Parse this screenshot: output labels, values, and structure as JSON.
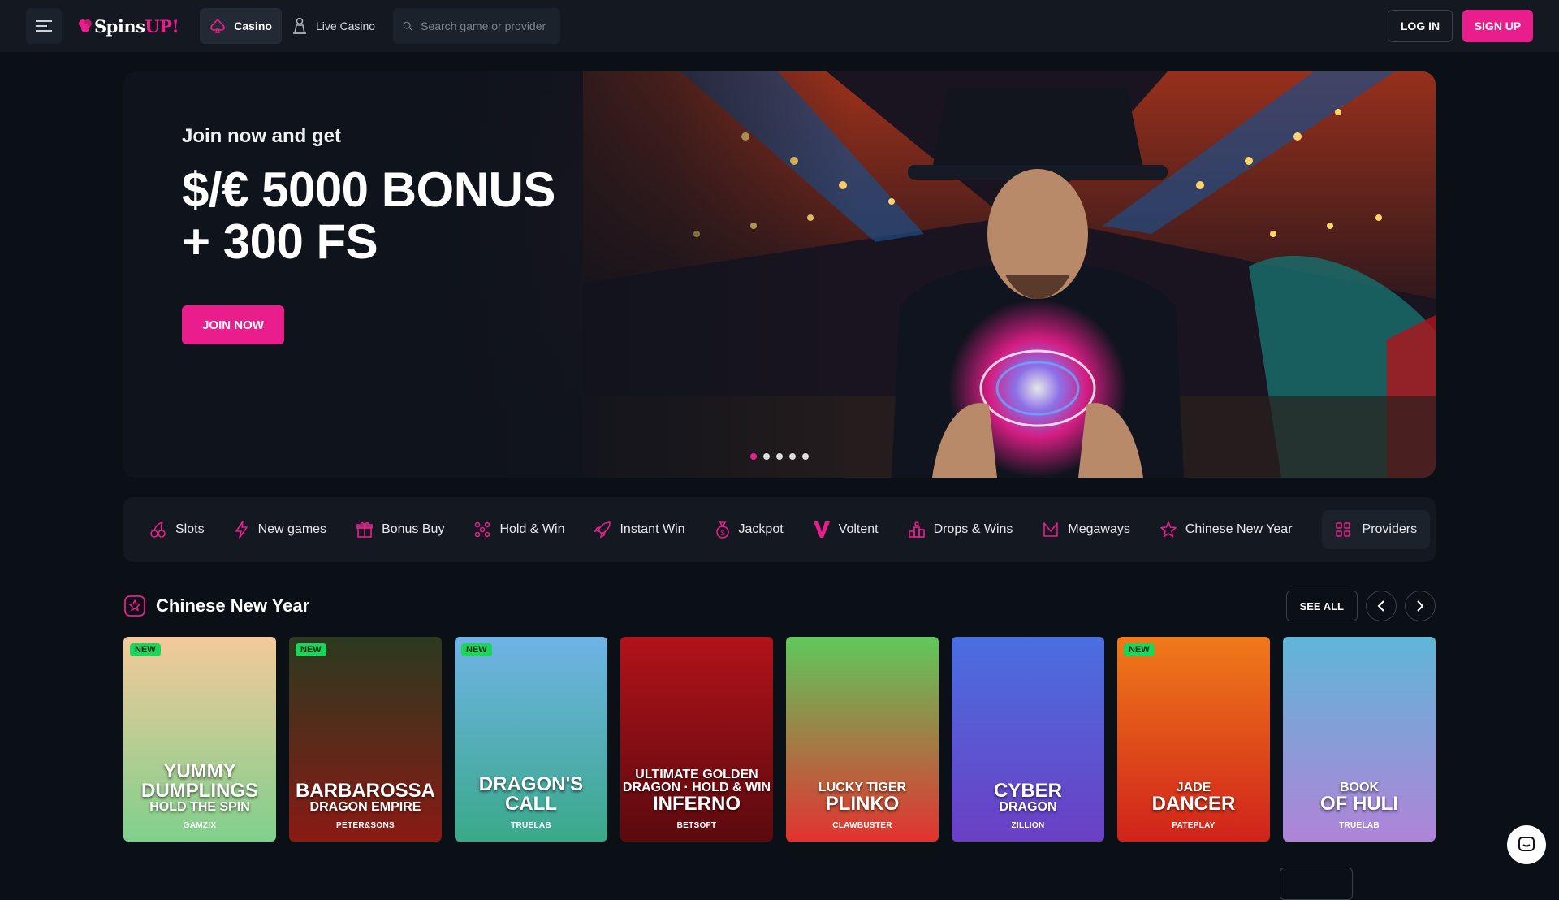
{
  "header": {
    "logo": {
      "brand": "Spins",
      "brand_up": "UP!"
    },
    "tabs": [
      {
        "label": "Casino"
      },
      {
        "label": "Live Casino"
      }
    ],
    "search": {
      "placeholder": "Search game or provider"
    },
    "login_label": "LOG IN",
    "signup_label": "SIGN UP"
  },
  "hero": {
    "kicker": "Join now and get",
    "title_line1": "$/€ 5000 BONUS",
    "title_line2": "+ 300 FS",
    "cta_label": "JOIN NOW",
    "slides": 5,
    "active_slide": 1
  },
  "categories": [
    {
      "label": "Slots",
      "icon": "cherries-icon"
    },
    {
      "label": "New games",
      "icon": "lightning-icon"
    },
    {
      "label": "Bonus Buy",
      "icon": "gift-icon"
    },
    {
      "label": "Hold & Win",
      "icon": "grid-dots-icon"
    },
    {
      "label": "Instant Win",
      "icon": "rocket-icon"
    },
    {
      "label": "Jackpot",
      "icon": "moneybag-icon"
    },
    {
      "label": "Voltent",
      "icon": "voltent-logo-icon"
    },
    {
      "label": "Drops & Wins",
      "icon": "podium-icon"
    },
    {
      "label": "Megaways",
      "icon": "megaways-icon"
    },
    {
      "label": "Chinese New Year",
      "icon": "star-icon"
    }
  ],
  "providers_label": "Providers",
  "section": {
    "title": "Chinese New Year",
    "see_all_label": "SEE ALL"
  },
  "games": [
    {
      "line1": "YUMMY DUMPLINGS",
      "line2": "HOLD THE SPIN",
      "provider": "GAMZIX",
      "badge": "NEW",
      "c1": "#f4c99a",
      "c2": "#7fd08c"
    },
    {
      "line1": "BARBAROSSA",
      "line2": "DRAGON EMPIRE",
      "provider": "PETER&SONS",
      "badge": "NEW",
      "c1": "#2b3a1f",
      "c2": "#8a1a14"
    },
    {
      "line1": "DRAGON'S CALL",
      "line2": "",
      "provider": "TRUELAB",
      "badge": "NEW",
      "c1": "#6fb3e6",
      "c2": "#3aa98a"
    },
    {
      "line1": "INFERNO",
      "line2": "ULTIMATE GOLDEN DRAGON · HOLD & WIN",
      "provider": "BETSOFT",
      "badge": "",
      "c1": "#b3121a",
      "c2": "#5a0a0e"
    },
    {
      "line1": "PLINKO",
      "line2": "LUCKY TIGER",
      "provider": "CLAWBUSTER",
      "badge": "",
      "c1": "#5fc85c",
      "c2": "#e2332f"
    },
    {
      "line1": "CYBER",
      "line2": "DRAGON",
      "provider": "ZILLION",
      "badge": "",
      "c1": "#4a6fe0",
      "c2": "#6b3fc4"
    },
    {
      "line1": "DANCER",
      "line2": "JADE",
      "provider": "PATEPLAY",
      "badge": "NEW",
      "c1": "#f07a1a",
      "c2": "#d0231b"
    },
    {
      "line1": "OF HULI",
      "line2": "BOOK",
      "provider": "TRUELAB",
      "badge": "",
      "c1": "#5fb6d8",
      "c2": "#b083d8"
    }
  ],
  "colors": {
    "accent": "#e91e8c",
    "badge": "#1bd65a"
  }
}
